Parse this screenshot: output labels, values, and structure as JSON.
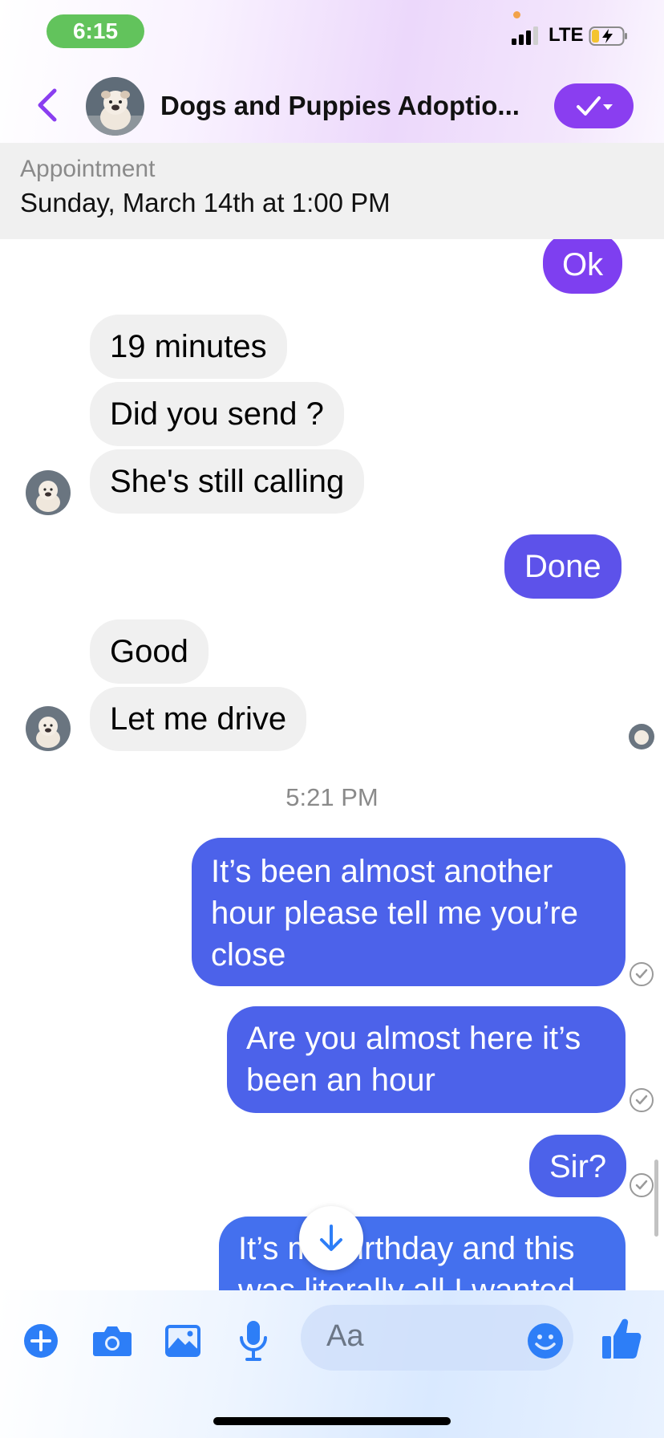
{
  "status_bar": {
    "time": "6:15",
    "network": "LTE"
  },
  "header": {
    "title": "Dogs  and Puppies  Adoptio...",
    "avatar_icon": "dog-avatar",
    "accent_color": "#8a3ef0"
  },
  "appointment": {
    "label": "Appointment",
    "date": "Sunday, March 14th at 1:00 PM"
  },
  "messages": [
    {
      "id": "m1",
      "sender": "me",
      "text": "Ok"
    },
    {
      "id": "m2",
      "sender": "them",
      "text": "19 minutes"
    },
    {
      "id": "m3",
      "sender": "them",
      "text": "Did you send ?"
    },
    {
      "id": "m4",
      "sender": "them",
      "text": "She's still calling"
    },
    {
      "id": "m5",
      "sender": "me",
      "text": "Done"
    },
    {
      "id": "m6",
      "sender": "them",
      "text": "Good"
    },
    {
      "id": "m7",
      "sender": "them",
      "text": "Let me drive"
    },
    {
      "id": "m8",
      "sender": "me",
      "text": "It’s been almost another hour please tell me you’re close"
    },
    {
      "id": "m9",
      "sender": "me",
      "text": "Are you almost here it’s been an hour"
    },
    {
      "id": "m10",
      "sender": "me",
      "text": "Sir?"
    },
    {
      "id": "m11",
      "sender": "me",
      "text": "It’s my birthday and this was literally all I wanted"
    }
  ],
  "timestamp": "5:21 PM",
  "composer": {
    "placeholder": "Aa",
    "icons": [
      "plus-icon",
      "camera-icon",
      "photo-icon",
      "microphone-icon",
      "emoji-icon",
      "thumbs-up-icon"
    ],
    "accent_color": "#2d7ef7"
  }
}
